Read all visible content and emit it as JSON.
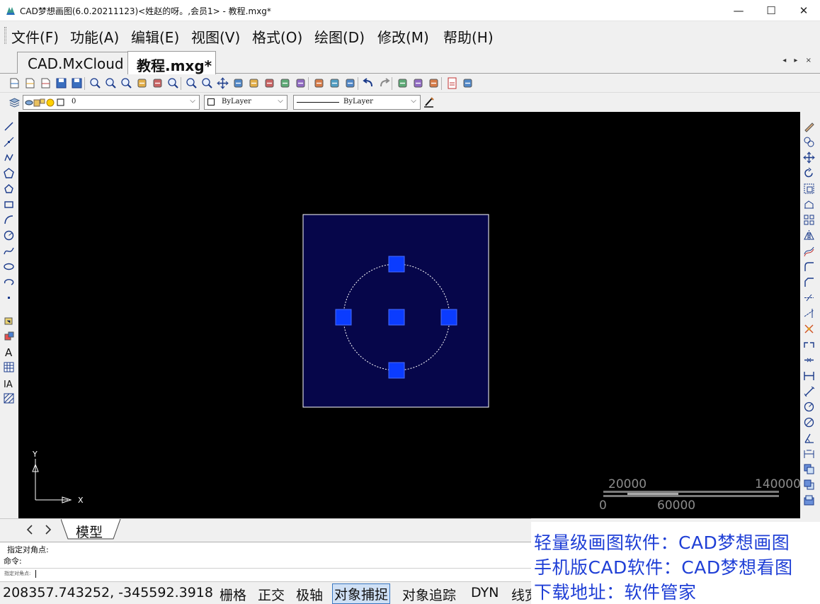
{
  "window": {
    "title": "CAD梦想画图(6.0.20211123)<姓赵的呀。,会员1> - 教程.mxg*",
    "min_glyph": "—",
    "max_glyph": "☐",
    "close_glyph": "✕"
  },
  "menu": {
    "items": [
      {
        "label": "文件(F)"
      },
      {
        "label": "功能(A)"
      },
      {
        "label": "编辑(E)"
      },
      {
        "label": "视图(V)"
      },
      {
        "label": "格式(O)"
      },
      {
        "label": "绘图(D)"
      },
      {
        "label": "修改(M)"
      },
      {
        "label": "帮助(H)"
      }
    ]
  },
  "doc_tabs": {
    "tab1": "CAD.MxCloud",
    "tab2": "教程.mxg*",
    "nav": "◂ ▸ ×"
  },
  "properties_bar": {
    "layer_value": "0",
    "color_value": "ByLayer",
    "linetype_value": "ByLayer"
  },
  "toolbar_icons": [
    "new-file-icon",
    "open-file-icon",
    "open-folder-icon",
    "save-icon",
    "save-all-icon",
    "zoom-realtime-icon",
    "zoom-window-icon",
    "zoom-extents-icon",
    "pan-icon",
    "ucs-icon",
    "zoom-previous-icon",
    "zoom-all-icon",
    "zoom-in-icon",
    "move-icon",
    "brush-icon",
    "color-picker-icon",
    "layer-stack-icon",
    "pen-icon",
    "export-icon",
    "match-properties-icon",
    "edit-properties-icon",
    "print-icon",
    "undo-icon",
    "redo-icon",
    "plot-icon",
    "render-icon",
    "render2-icon",
    "pdf-icon",
    "image-icon"
  ],
  "left_tools": [
    "line-icon",
    "construction-line-icon",
    "polyline-icon",
    "polygon-icon",
    "pentagon-icon",
    "rectangle-icon",
    "arc-icon",
    "circle-icon",
    "spline-icon",
    "ellipse-icon",
    "ellipse-arc-icon",
    "point-icon",
    "insert-block-icon",
    "make-block-icon",
    "text-icon",
    "table-icon",
    "mtext-icon",
    "hatch-icon"
  ],
  "right_tools": [
    "erase-icon",
    "copy-icon",
    "move-icon",
    "rotate-icon",
    "scale-icon",
    "stretch-icon",
    "array-icon",
    "mirror-icon",
    "offset-icon",
    "fillet-icon",
    "chamfer-icon",
    "trim-icon",
    "extend-icon",
    "explode-icon",
    "break-icon",
    "join-icon",
    "dim-linear-icon",
    "dim-aligned-icon",
    "dim-radius-icon",
    "dim-diameter-icon",
    "dim-angle-icon",
    "dim-baseline-icon",
    "draw-order-front-icon",
    "draw-order-back-icon",
    "draw-order-above-icon"
  ],
  "drawing": {
    "canvas_bg": "#000000",
    "selection_fill": "#06064a",
    "selection_border": "#ffffff",
    "grip_color": "#0b3cff",
    "circle_color": "#ffffff"
  },
  "ucs": {
    "x_label": "X",
    "y_label": "Y"
  },
  "scale_bar": {
    "top_left": "20000",
    "top_right": "140000",
    "bottom_left": "0",
    "bottom_mid": "60000"
  },
  "layout": {
    "model_tab": "模型"
  },
  "command": {
    "line1": "指定对角点:",
    "line2": "命令:",
    "input_prompt": "指定对角点:"
  },
  "status": {
    "coords": "208357.743252,  -345592.3918",
    "items": [
      {
        "label": "栅格",
        "active": false
      },
      {
        "label": "正交",
        "active": false
      },
      {
        "label": "极轴",
        "active": false
      },
      {
        "label": "对象捕捉",
        "active": true
      },
      {
        "label": "对象追踪",
        "active": false
      },
      {
        "label": "DYN",
        "active": false
      },
      {
        "label": "线宽",
        "active": false
      }
    ]
  },
  "promo": {
    "line1": "轻量级画图软件：CAD梦想画图",
    "line2": "手机版CAD软件：CAD梦想看图",
    "line3": "下载地址：软件管家"
  }
}
